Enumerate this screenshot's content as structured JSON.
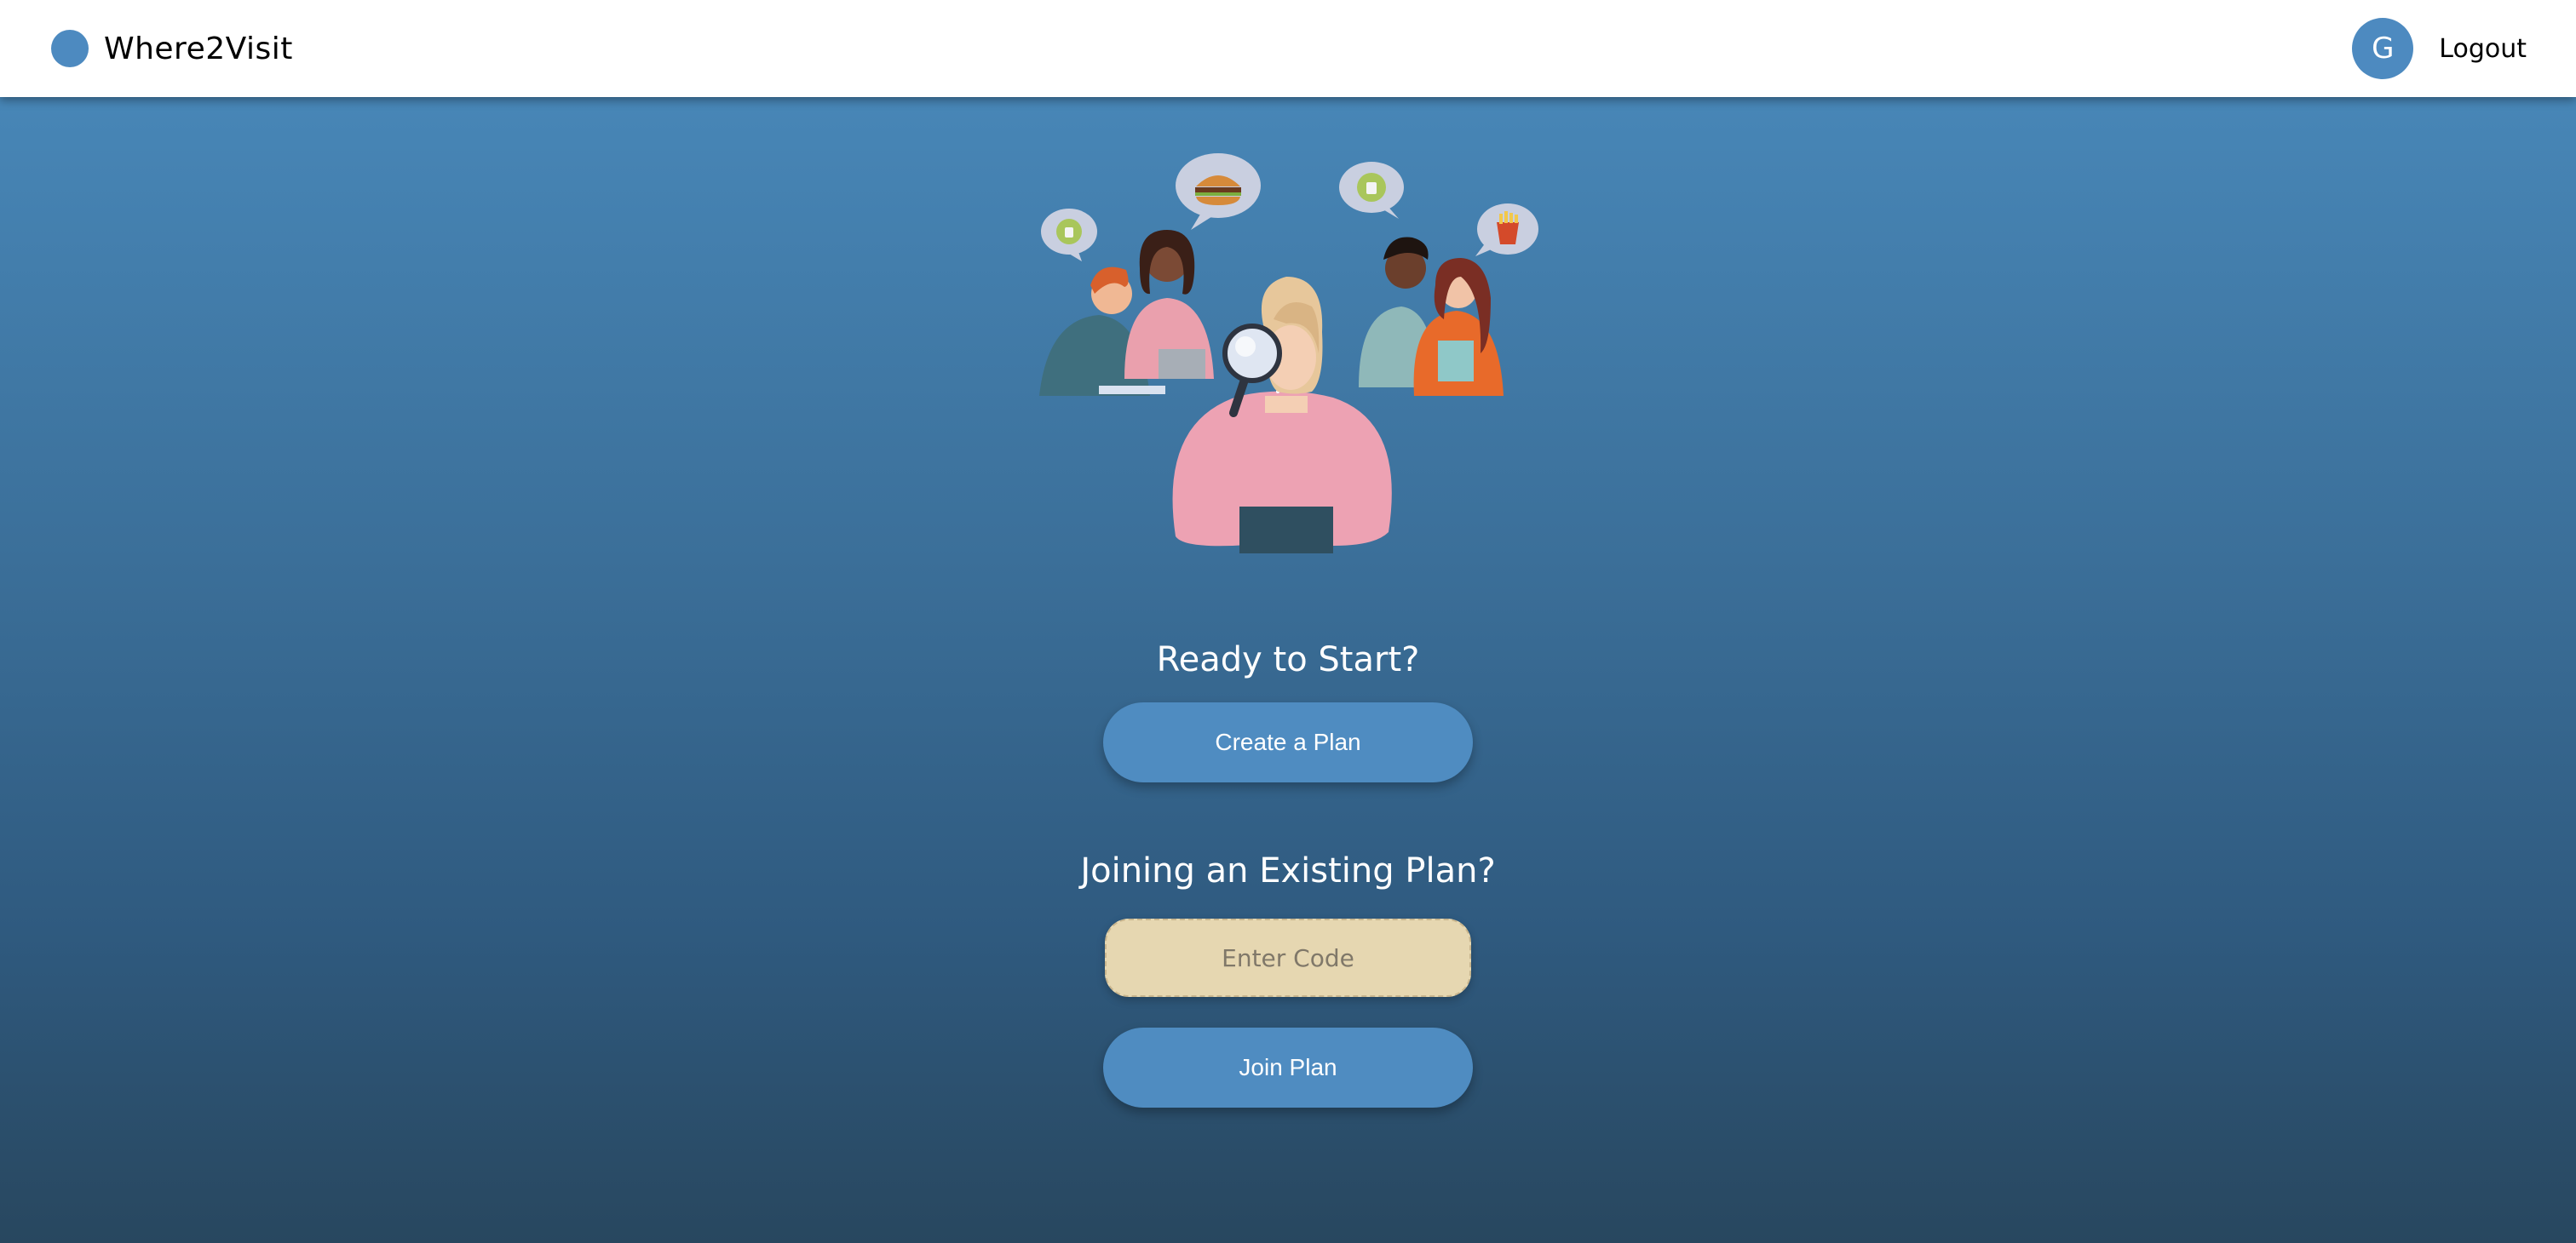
{
  "header": {
    "brand_name": "Where2Visit",
    "avatar_initial": "G",
    "logout_label": "Logout"
  },
  "start_section": {
    "heading": "Ready to Start?",
    "create_button_label": "Create a Plan"
  },
  "join_section": {
    "heading": "Joining an Existing Plan?",
    "code_placeholder": "Enter Code",
    "code_value": "",
    "join_button_label": "Join Plan"
  },
  "illustration": {
    "icons": [
      "thumbs-up-bubble",
      "burger-bubble",
      "thumbs-up-bubble",
      "fries-bubble",
      "magnifying-glass"
    ]
  },
  "colors": {
    "accent": "#4f8cc1",
    "input_bg": "#e6d7b1",
    "header_bg": "#ffffff",
    "bg_top": "#4a8bbd",
    "bg_bottom": "#28475f"
  }
}
